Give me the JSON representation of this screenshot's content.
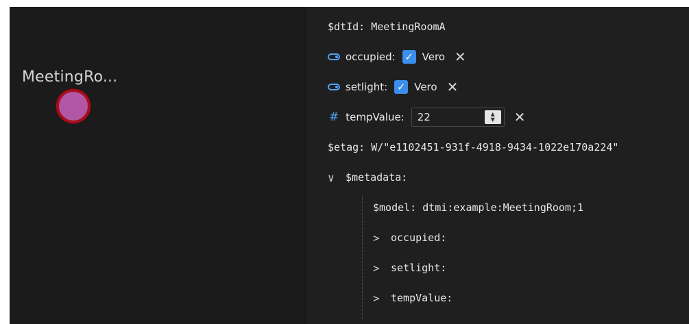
{
  "graph": {
    "node_label": "MeetingRo...",
    "node_fill": "#b157a6",
    "node_border": "#a50f1b"
  },
  "properties": {
    "dtId_row": "$dtId: MeetingRoomA",
    "occupied": {
      "icon": "toggle-icon",
      "label": "occupied:",
      "checked": true,
      "value_text": "Vero"
    },
    "setlight": {
      "icon": "toggle-icon",
      "label": "setlight:",
      "checked": true,
      "value_text": "Vero"
    },
    "tempValue": {
      "icon": "hash-icon",
      "label": "tempValue:",
      "value": "22"
    },
    "etag_row": "$etag: W/\"e1102451-931f-4918-9434-1022e170a224\"",
    "metadata": {
      "label": "$metadata:",
      "expanded": true,
      "model_row": "$model: dtmi:example:MeetingRoom;1",
      "children": [
        {
          "label": "occupied:",
          "expanded": false
        },
        {
          "label": "setlight:",
          "expanded": false
        },
        {
          "label": "tempValue:",
          "expanded": false
        }
      ]
    }
  },
  "colors": {
    "background": "#1f1f1f",
    "accent": "#3b8eea",
    "icon_blue": "#4ea1f3"
  }
}
